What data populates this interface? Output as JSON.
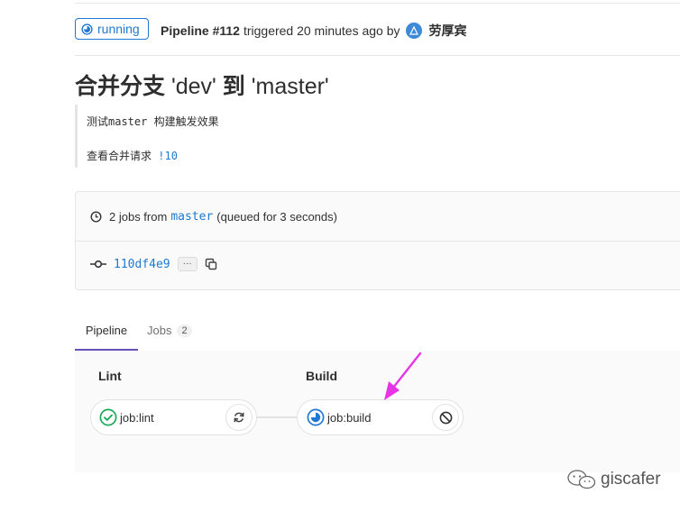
{
  "header": {
    "status": "running",
    "pipeline_label": "Pipeline #112",
    "triggered_text": "triggered 20 minutes ago by",
    "author": "劳厚宾",
    "status_color": "#1f78d1"
  },
  "title": {
    "prefix": "合并分支",
    "source_branch": "'dev'",
    "connector": "到",
    "target_branch": "'master'"
  },
  "commit_description": {
    "line1": "测试master 构建触发效果",
    "line2_text": "查看合并请求",
    "line2_link": "!10"
  },
  "summary": {
    "jobs_text": "2 jobs from",
    "branch": "master",
    "queued_text": "(queued for 3 seconds)",
    "commit_sha": "110df4e9",
    "more_label": "···"
  },
  "tabs": {
    "pipeline": "Pipeline",
    "jobs": "Jobs",
    "jobs_count": "2"
  },
  "stages": [
    {
      "name": "Lint",
      "job": "job:lint",
      "status": "success",
      "action_icon": "retry-icon"
    },
    {
      "name": "Build",
      "job": "job:build",
      "status": "running",
      "action_icon": "cancel-icon"
    }
  ],
  "colors": {
    "accent": "#1f78d1",
    "success": "#1aaa55",
    "tab_active": "#6b4fbb",
    "annotation": "#e535e5"
  },
  "watermark": "giscafer"
}
